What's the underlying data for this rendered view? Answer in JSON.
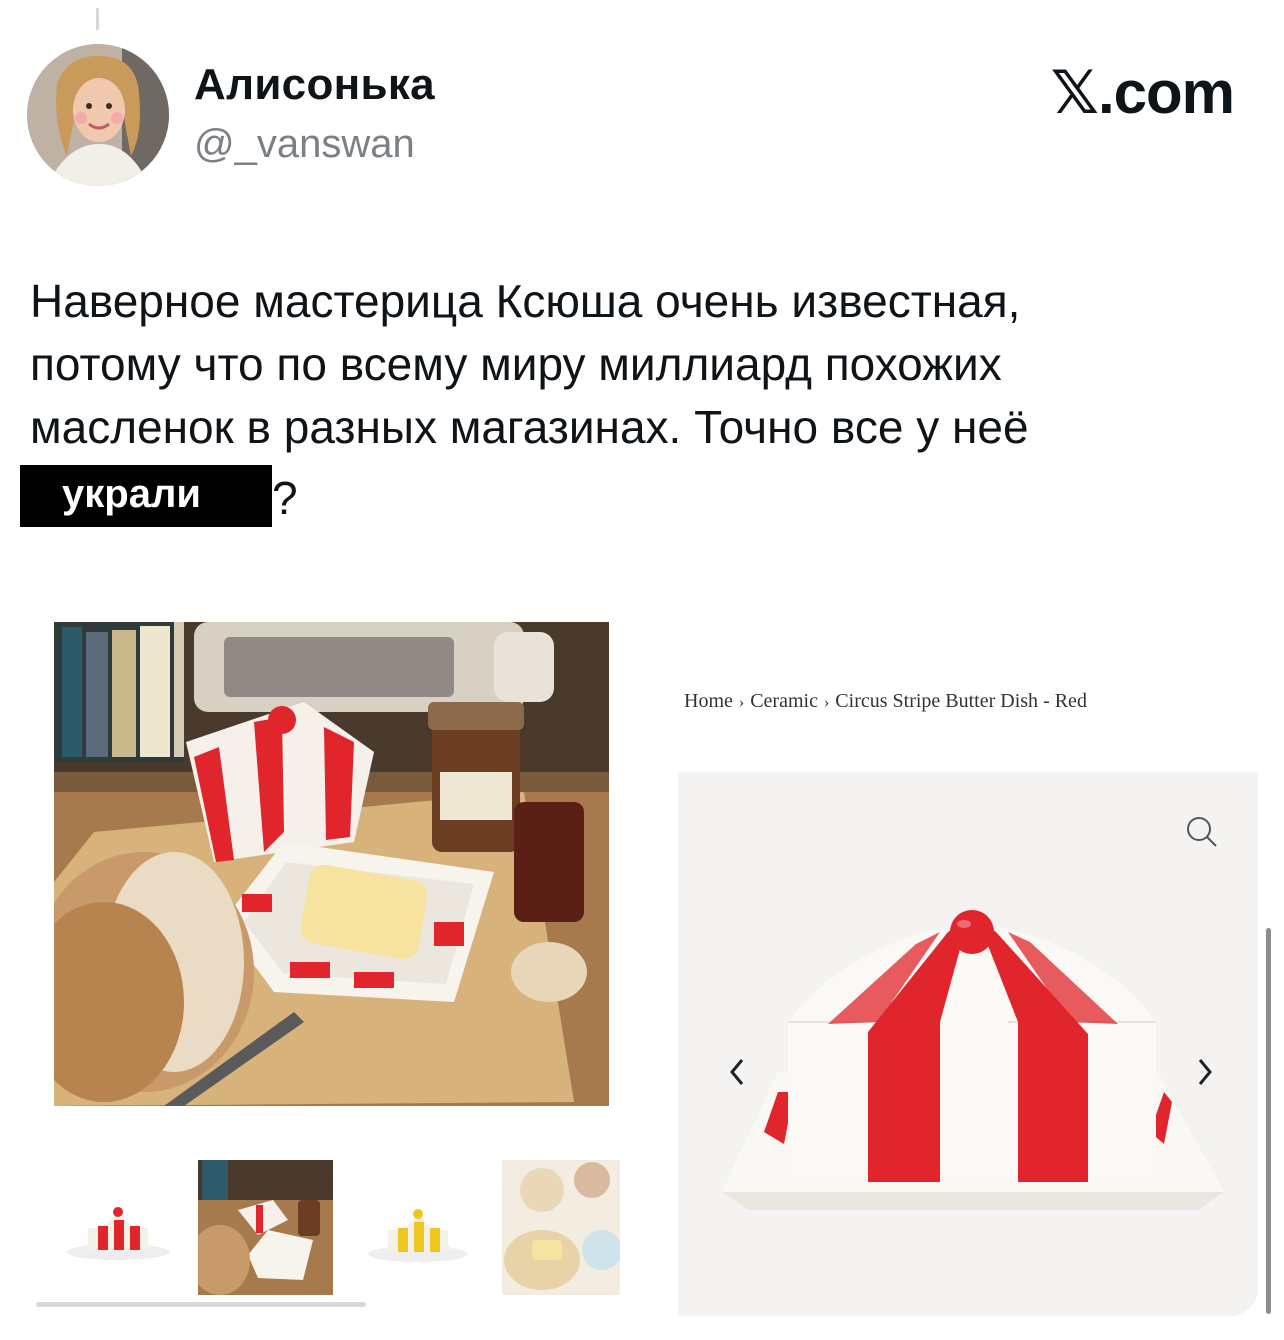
{
  "tweet": {
    "display_name": "Алисонька",
    "handle": "@_vanswan",
    "brand": "𝕏.com",
    "text_lines": [
      "Наверное мастерица Ксюша очень известная,",
      "потому что по всему миру миллиард похожих",
      "масленок в разных магазинах. Точно все у неё"
    ],
    "censored_word": "украли",
    "end_punct": "?"
  },
  "product_page": {
    "breadcrumb": [
      "Home",
      "Ceramic",
      "Circus Stripe Butter Dish - Red"
    ]
  },
  "colors": {
    "stripe_red": "#e0252c",
    "censor_bg": "#000000"
  },
  "icons": [
    "zoom-icon",
    "chevron-left-icon",
    "chevron-right-icon"
  ]
}
